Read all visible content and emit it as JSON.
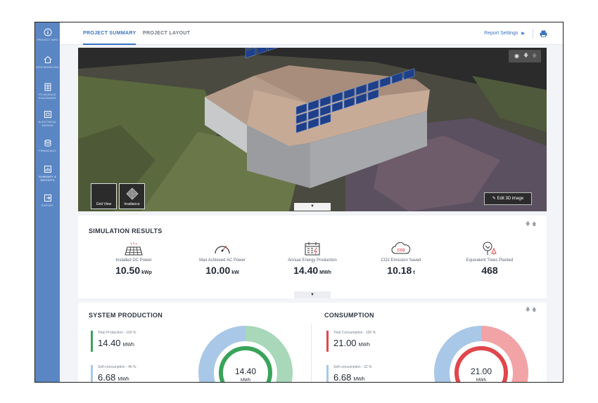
{
  "sidebar": {
    "items": [
      {
        "label": "Project Info",
        "icon": "info-icon"
      },
      {
        "label": "Site Modeling",
        "icon": "home-icon"
      },
      {
        "label": "PV Module Placement",
        "icon": "panel-icon"
      },
      {
        "label": "Electrical Design",
        "icon": "chip-icon"
      },
      {
        "label": "Financials",
        "icon": "coins-icon"
      },
      {
        "label": "Summary & Reports",
        "icon": "report-icon"
      },
      {
        "label": "Export",
        "icon": "export-icon"
      }
    ]
  },
  "tabs": [
    {
      "label": "PROJECT SUMMARY",
      "active": true
    },
    {
      "label": "PROJECT LAYOUT",
      "active": false
    }
  ],
  "header": {
    "report_settings": "Report Settings",
    "print_icon": "print-icon"
  },
  "viewer": {
    "grid_view": "Grid View",
    "irradiance": "Irradiance",
    "edit_3d": "Edit 3D image"
  },
  "simulation": {
    "title": "SIMULATION RESULTS",
    "metrics": [
      {
        "label": "Installed DC Power",
        "value": "10.50",
        "unit": "kWp",
        "icon": "solar-panel-icon"
      },
      {
        "label": "Max Achieved AC Power",
        "value": "10.00",
        "unit": "kW",
        "icon": "gauge-icon"
      },
      {
        "label": "Annual Energy Production",
        "value": "14.40",
        "unit": "MWh",
        "icon": "calendar-energy-icon"
      },
      {
        "label": "CO2 Emission Saved",
        "value": "10.18",
        "unit": "t",
        "icon": "co2-cloud-icon"
      },
      {
        "label": "Equivalent Trees Planted",
        "value": "468",
        "unit": "",
        "icon": "trees-icon"
      }
    ],
    "co2_badge": "CO2"
  },
  "production": {
    "title": "SYSTEM PRODUCTION",
    "stats": [
      {
        "label": "Total Production - 100 %",
        "value": "14.40",
        "unit": "MWh",
        "color": "#3aa35a"
      },
      {
        "label": "Self-consumption - 46 %",
        "value": "6.68",
        "unit": "MWh",
        "color": "#a9c8e8"
      }
    ],
    "donut_value": "14.40",
    "donut_unit": "MWh",
    "self_consumption_share": 0.46,
    "colors": {
      "ring": "#3aa35a",
      "outer_main": "#a8d8b9",
      "outer_self": "#a9c8e8"
    }
  },
  "consumption": {
    "title": "CONSUMPTION",
    "stats": [
      {
        "label": "Total Consumption - 100 %",
        "value": "21.00",
        "unit": "MWh",
        "color": "#e0474c"
      },
      {
        "label": "Self-consumption - 32 %",
        "value": "6.68",
        "unit": "MWh",
        "color": "#a9c8e8"
      }
    ],
    "donut_value": "21.00",
    "donut_unit": "MWh",
    "self_consumption_share": 0.32,
    "colors": {
      "ring": "#e0474c",
      "outer_main": "#f2a3a6",
      "outer_self": "#a9c8e8"
    }
  }
}
